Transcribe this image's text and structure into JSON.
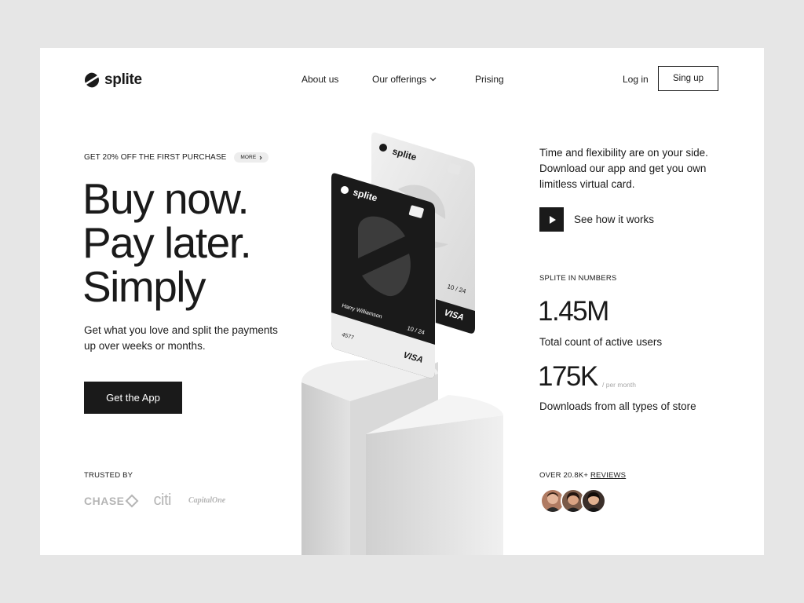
{
  "brand": {
    "name": "splite"
  },
  "nav": {
    "items": [
      {
        "label": "About us"
      },
      {
        "label": "Our offerings"
      },
      {
        "label": "Prising"
      }
    ],
    "login_label": "Log in",
    "signup_label": "Sing up"
  },
  "promo": {
    "text": "GET 20% OFF THE FIRST PURCHASE",
    "badge_label": "MORE"
  },
  "headline": {
    "line1": "Buy now.",
    "line2": "Pay later.",
    "line3": "Simply"
  },
  "subtext": "Get what you love and split the payments up over weeks or months.",
  "cta": {
    "get_app_label": "Get the App"
  },
  "trusted": {
    "label": "TRUSTED BY",
    "partners": [
      "CHASE",
      "citi",
      "CapitalOne"
    ]
  },
  "intro": "Time and flexibility are on your side. Download our app and get you own limitless virtual card.",
  "video": {
    "label": "See how it works"
  },
  "numbers": {
    "label": "SPLITE IN NUMBERS",
    "stats": [
      {
        "value": "1.45M",
        "caption": "Total count of active users"
      },
      {
        "value": "175K",
        "unit": "/ per month",
        "caption": "Downloads from all types of store"
      }
    ]
  },
  "reviews": {
    "prefix": "OVER 20.8K+",
    "link_label": "REVIEWS"
  },
  "cards": {
    "front": {
      "brand": "splite",
      "holder": "Harry Williamson",
      "expiry": "10 / 24",
      "number": "4577",
      "network": "VISA"
    },
    "back": {
      "brand": "splite",
      "expiry": "10 / 24",
      "network": "VISA"
    }
  },
  "icons": {
    "chevron": "chevron-down-icon",
    "play": "play-icon",
    "logo": "splite-logo-icon"
  },
  "colors": {
    "accent": "#1a1a1a",
    "background": "#e6e6e6",
    "surface": "#ffffff"
  }
}
